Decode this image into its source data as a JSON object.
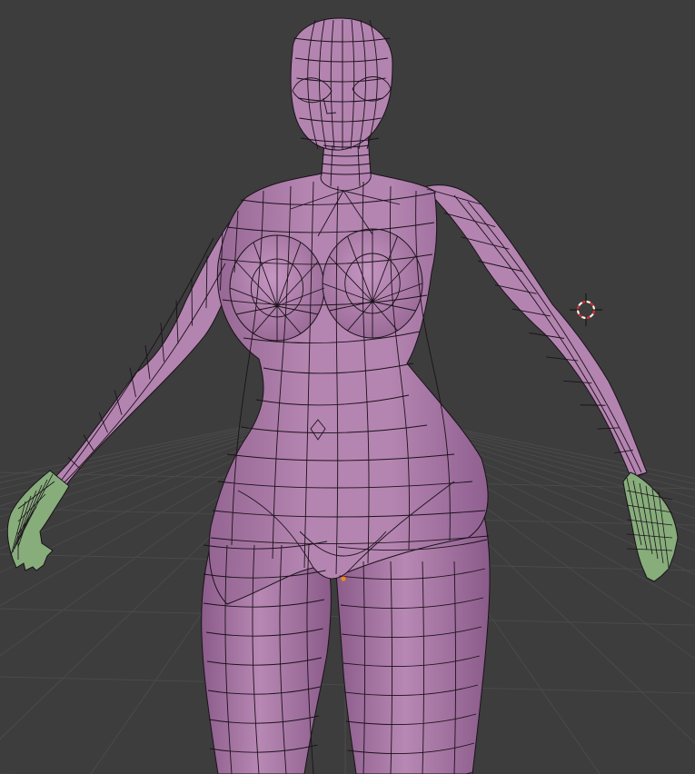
{
  "viewport": {
    "background_color": "#3d3d3d",
    "grid_line_color": "#4a4a4a"
  },
  "mesh": {
    "body_color": "#b484b0",
    "body_shade_color": "#9a6a96",
    "body_highlight_color": "#c99bc5",
    "hand_color": "#87ad7b",
    "wire_color": "#1b121b"
  },
  "cursor_3d": {
    "icon": "3d-cursor-icon",
    "ring_color_a": "#d93030",
    "ring_color_b": "#f2f2f2",
    "cross_color": "#101010"
  },
  "origin_marker": {
    "icon": "object-origin-icon",
    "color": "#f08a14"
  }
}
